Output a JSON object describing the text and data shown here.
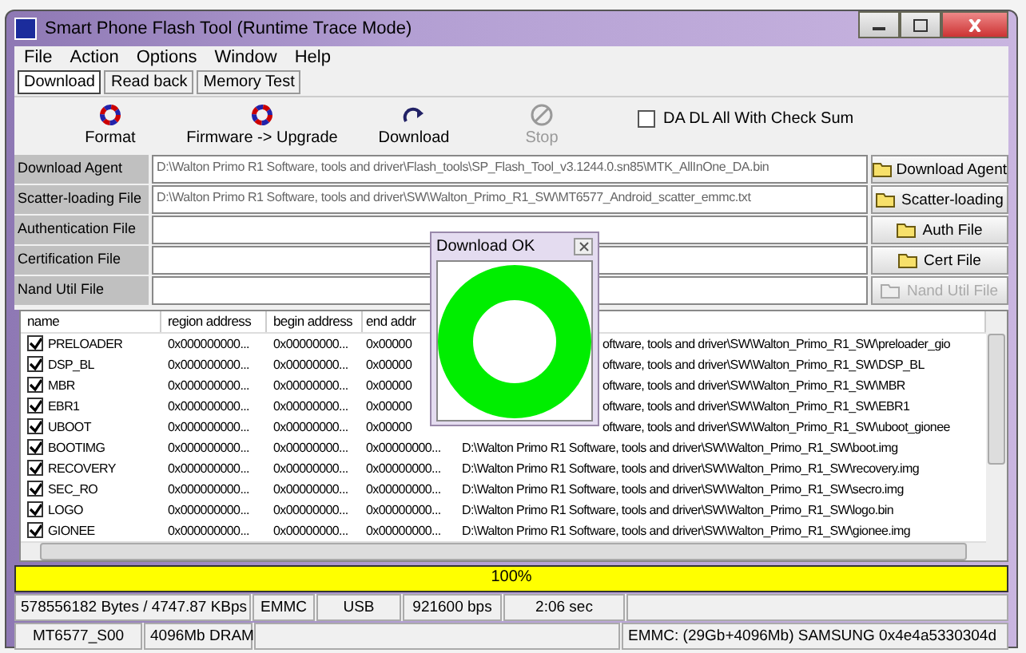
{
  "window": {
    "title": "Smart Phone Flash Tool (Runtime Trace Mode)"
  },
  "menu": [
    "File",
    "Action",
    "Options",
    "Window",
    "Help"
  ],
  "tabs": [
    {
      "label": "Download",
      "selected": true
    },
    {
      "label": "Read back",
      "selected": false
    },
    {
      "label": "Memory Test",
      "selected": false
    }
  ],
  "toolbar": [
    {
      "kind": "format",
      "label": "Format",
      "disabled": false
    },
    {
      "kind": "firmware",
      "label": "Firmware -> Upgrade",
      "disabled": false
    },
    {
      "kind": "download",
      "label": "Download",
      "disabled": false
    },
    {
      "kind": "stop",
      "label": "Stop",
      "disabled": true
    }
  ],
  "checksum": {
    "label": "DA DL All With Check Sum",
    "checked": false
  },
  "files": [
    {
      "label": "Download Agent",
      "value": "D:\\Walton Primo R1 Software, tools and driver\\Flash_tools\\SP_Flash_Tool_v3.1244.0.sn85\\MTK_AllInOne_DA.bin",
      "button": "Download Agent",
      "disabled": false
    },
    {
      "label": "Scatter-loading File",
      "value": "D:\\Walton Primo R1 Software, tools and driver\\SW\\Walton_Primo_R1_SW\\MT6577_Android_scatter_emmc.txt",
      "button": "Scatter-loading",
      "disabled": false
    },
    {
      "label": "Authentication File",
      "button": "Auth File",
      "disabled": false
    },
    {
      "label": "Certification File",
      "button": "Cert File",
      "disabled": false
    },
    {
      "label": "Nand Util File",
      "button": "Nand Util File",
      "disabled": true
    }
  ],
  "table": {
    "columns": [
      "name",
      "region address",
      "begin address",
      "end addr"
    ],
    "rows": [
      {
        "checked": true,
        "name": "PRELOADER",
        "region": "0x000000000...",
        "begin": "0x00000000...",
        "end": "0x00000",
        "location": "oftware, tools and driver\\SW\\Walton_Primo_R1_SW\\preloader_gio",
        "partly_hidden": true
      },
      {
        "checked": true,
        "name": "DSP_BL",
        "region": "0x000000000...",
        "begin": "0x00000000...",
        "end": "0x00000",
        "location": "oftware, tools and driver\\SW\\Walton_Primo_R1_SW\\DSP_BL",
        "partly_hidden": true
      },
      {
        "checked": true,
        "name": "MBR",
        "region": "0x000000000...",
        "begin": "0x00000000...",
        "end": "0x00000",
        "location": "oftware, tools and driver\\SW\\Walton_Primo_R1_SW\\MBR",
        "partly_hidden": true
      },
      {
        "checked": true,
        "name": "EBR1",
        "region": "0x000000000...",
        "begin": "0x00000000...",
        "end": "0x00000",
        "location": "oftware, tools and driver\\SW\\Walton_Primo_R1_SW\\EBR1",
        "partly_hidden": true
      },
      {
        "checked": true,
        "name": "UBOOT",
        "region": "0x000000000...",
        "begin": "0x00000000...",
        "end": "0x00000",
        "location": "oftware, tools and driver\\SW\\Walton_Primo_R1_SW\\uboot_gionee",
        "partly_hidden": true
      },
      {
        "checked": true,
        "name": "BOOTIMG",
        "region": "0x000000000...",
        "begin": "0x00000000...",
        "end": "0x00000000...",
        "location": "D:\\Walton Primo R1 Software, tools and driver\\SW\\Walton_Primo_R1_SW\\boot.img",
        "partly_hidden": false
      },
      {
        "checked": true,
        "name": "RECOVERY",
        "region": "0x000000000...",
        "begin": "0x00000000...",
        "end": "0x00000000...",
        "location": "D:\\Walton Primo R1 Software, tools and driver\\SW\\Walton_Primo_R1_SW\\recovery.img",
        "partly_hidden": false
      },
      {
        "checked": true,
        "name": "SEC_RO",
        "region": "0x000000000...",
        "begin": "0x00000000...",
        "end": "0x00000000...",
        "location": "D:\\Walton Primo R1 Software, tools and driver\\SW\\Walton_Primo_R1_SW\\secro.img",
        "partly_hidden": false
      },
      {
        "checked": true,
        "name": "LOGO",
        "region": "0x000000000...",
        "begin": "0x00000000...",
        "end": "0x00000000...",
        "location": "D:\\Walton Primo R1 Software, tools and driver\\SW\\Walton_Primo_R1_SW\\logo.bin",
        "partly_hidden": false
      },
      {
        "checked": true,
        "name": "GIONEE",
        "region": "0x000000000...",
        "begin": "0x00000000...",
        "end": "0x00000000...",
        "location": "D:\\Walton Primo R1 Software, tools and driver\\SW\\Walton_Primo_R1_SW\\gionee.img",
        "partly_hidden": false
      }
    ]
  },
  "dialog": {
    "title": "Download OK"
  },
  "progress": {
    "label": "100%",
    "level": 1
  },
  "status_bar": {
    "row_1": [
      "578556182 Bytes / 4747.87 KBps",
      "EMMC",
      "USB",
      "921600 bps",
      "2:06 sec"
    ],
    "row_2": [
      "MT6577_S00",
      "4096Mb DRAM",
      "EMMC: (29Gb+4096Mb) SAMSUNG 0x4e4a5330304d"
    ]
  }
}
